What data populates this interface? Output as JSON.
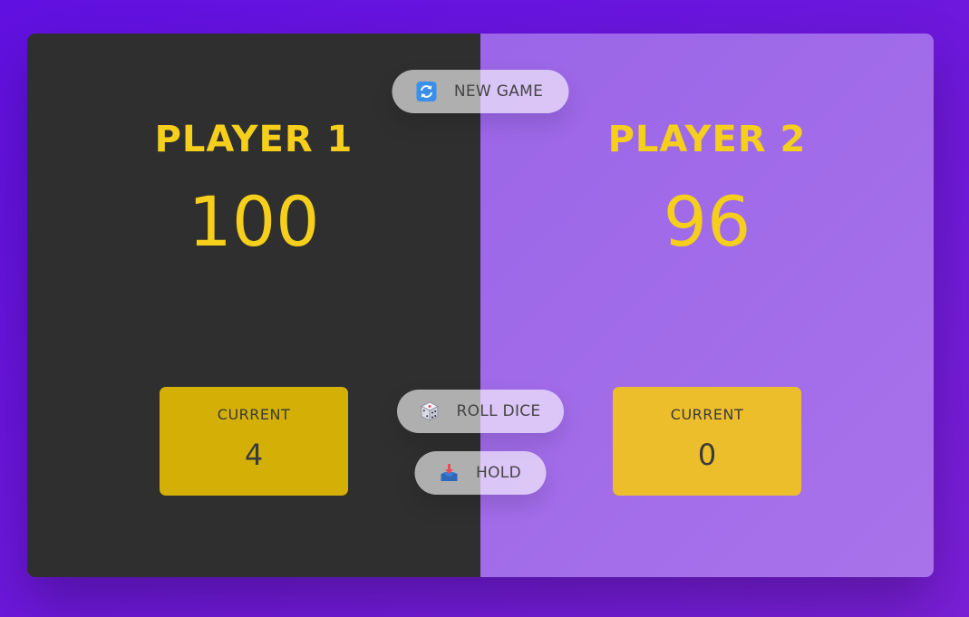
{
  "players": [
    {
      "name": "PLAYER 1",
      "score": "100",
      "current_label": "CURRENT",
      "current": "4"
    },
    {
      "name": "PLAYER 2",
      "score": "96",
      "current_label": "CURRENT",
      "current": "0"
    }
  ],
  "buttons": {
    "new_game": {
      "label": "NEW GAME",
      "icon": "refresh-icon"
    },
    "roll_dice": {
      "label": "ROLL DICE",
      "icon": "dice-icon"
    },
    "hold": {
      "label": "HOLD",
      "icon": "inbox-tray-icon"
    }
  },
  "colors": {
    "background": "#6010e0",
    "winner_panel": "#2f2f2f",
    "other_panel": "#a06ce8",
    "accent_yellow": "#f5cf1b",
    "current_box_winner": "#d4b007",
    "current_box_other": "#edbe2c"
  }
}
